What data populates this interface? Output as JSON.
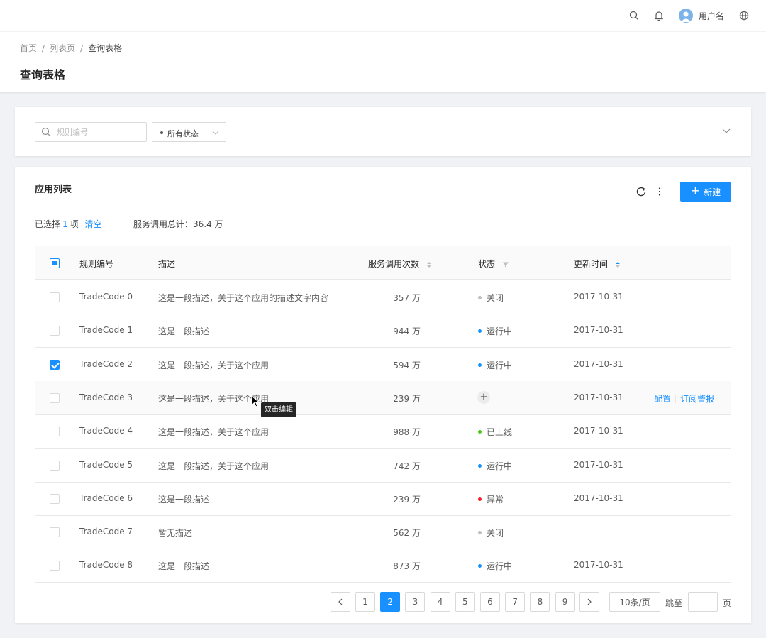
{
  "header": {
    "username": "用户名"
  },
  "breadcrumb": [
    "首页",
    "列表页",
    "查询表格"
  ],
  "page_title": "查询表格",
  "filters": {
    "search_placeholder": "规则编号",
    "status_label": "所有状态"
  },
  "list": {
    "title": "应用列表",
    "new_button": "新建",
    "selected_prefix": "已选择",
    "selected_count": "1",
    "selected_suffix": "项",
    "clear_label": "清空",
    "total_label": "服务调用总计：36.4 万"
  },
  "table": {
    "columns": [
      "规则编号",
      "描述",
      "服务调用次数",
      "状态",
      "更新时间"
    ],
    "rows": [
      {
        "code": "TradeCode 0",
        "desc": "这是一段描述，关于这个应用的描述文字内容",
        "calls": "357 万",
        "status": "关闭",
        "status_color": "#bfbfbf",
        "updated": "2017-10-31",
        "checked": false
      },
      {
        "code": "TradeCode 1",
        "desc": "这是一段描述",
        "calls": "944 万",
        "status": "运行中",
        "status_color": "#1890ff",
        "updated": "2017-10-31",
        "checked": false
      },
      {
        "code": "TradeCode 2",
        "desc": "这是一段描述，关于这个应用",
        "calls": "594 万",
        "status": "运行中",
        "status_color": "#1890ff",
        "updated": "2017-10-31",
        "checked": true
      },
      {
        "code": "TradeCode 3",
        "desc": "这是一段描述，关于这个应用",
        "calls": "239 万",
        "status": "",
        "status_color": "",
        "updated": "2017-10-31",
        "checked": false,
        "hover": true
      },
      {
        "code": "TradeCode 4",
        "desc": "这是一段描述，关于这个应用",
        "calls": "988 万",
        "status": "已上线",
        "status_color": "#52c41a",
        "updated": "2017-10-31",
        "checked": false
      },
      {
        "code": "TradeCode 5",
        "desc": "这是一段描述，关于这个应用",
        "calls": "742 万",
        "status": "运行中",
        "status_color": "#1890ff",
        "updated": "2017-10-31",
        "checked": false
      },
      {
        "code": "TradeCode 6",
        "desc": "这是一段描述",
        "calls": "239 万",
        "status": "异常",
        "status_color": "#f5222d",
        "updated": "2017-10-31",
        "checked": false
      },
      {
        "code": "TradeCode 7",
        "desc": "暂无描述",
        "calls": "562 万",
        "status": "关闭",
        "status_color": "#bfbfbf",
        "updated": "–",
        "checked": false
      },
      {
        "code": "TradeCode 8",
        "desc": "这是一段描述",
        "calls": "873 万",
        "status": "运行中",
        "status_color": "#1890ff",
        "updated": "2017-10-31",
        "checked": false
      }
    ],
    "row_actions": [
      "配置",
      "订阅警报"
    ],
    "tooltip": "双击编辑"
  },
  "pagination": {
    "pages": [
      "1",
      "2",
      "3",
      "4",
      "5",
      "6",
      "7",
      "8",
      "9"
    ],
    "current": "2",
    "page_size": "10条/页",
    "jump_label": "跳至",
    "page_suffix": "页"
  },
  "colors": {
    "primary": "#1890ff"
  }
}
